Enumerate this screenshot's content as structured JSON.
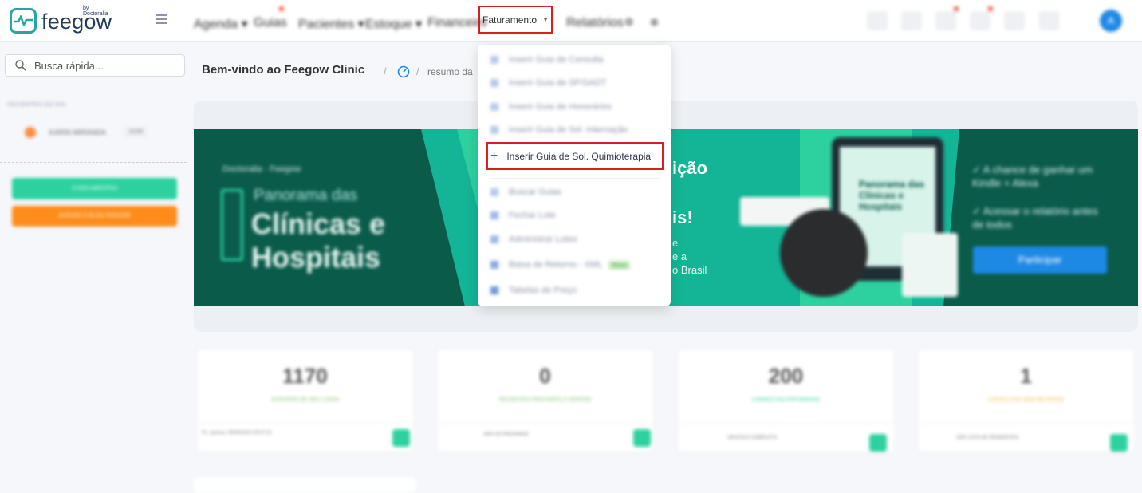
{
  "app": {
    "logo_text": "feegow",
    "logo_by": "by Doctoralia"
  },
  "nav": {
    "items": [
      "Agenda",
      "Guias",
      "Pacientes",
      "Estoque",
      "Financeiro"
    ],
    "active": "Faturamento",
    "after": [
      "Relatórios"
    ]
  },
  "search": {
    "placeholder": "Busca rápida..."
  },
  "sidebar": {
    "section_label": "PACIENTES DO DIA",
    "patient_name": "KARIN MIRANDA",
    "patient_badge": "10:00",
    "green_button": "0 DOCUMENTOS",
    "orange_button": "ACESSE O BLOG FEEGOW"
  },
  "breadcrumb": {
    "title": "Bem-vindo ao Feegow Clinic",
    "sub": "resumo da"
  },
  "dropdown": {
    "items": [
      {
        "label": "Inserir Guia de Consulta",
        "icon": "plus-icon"
      },
      {
        "label": "Inserir Guia de SP/SADT",
        "icon": "plus-icon"
      },
      {
        "label": "Inserir Guia de Honorários",
        "icon": "plus-icon"
      },
      {
        "label": "Inserir Guia de Sol. Internação",
        "icon": "plus-icon"
      }
    ],
    "highlighted": "Inserir Guia de Sol. Quimioterapia",
    "items2": [
      {
        "label": "Buscar Guias",
        "icon": "search-icon"
      },
      {
        "label": "Fechar Lote",
        "icon": "lock-icon"
      },
      {
        "label": "Administrar Lotes",
        "icon": "folder-icon"
      },
      {
        "label": "Baixa de Retorno - XML",
        "icon": "upload-icon",
        "badge": "Novo"
      },
      {
        "label": "Tabelas de Preço",
        "icon": "table-icon"
      }
    ]
  },
  "banner": {
    "brand": "Doctoralia · Feegow",
    "subtitle": "Panorama das",
    "title_line1": "Clínicas e",
    "title_line2": "Hospitais",
    "fragment_top": "ição",
    "fragment_mid": "is!",
    "fragment_lines": [
      "e",
      "e a",
      "o Brasil"
    ],
    "book_title": "Panorama das Clínicas e Hospitais",
    "checks": [
      "A chance de ganhar um Kindle + Alexa",
      "Acessar o relatório antes de todos"
    ],
    "cta": "Participar"
  },
  "stats": [
    {
      "value": "1170",
      "label": "ACESSOS DE SEU LOGIN",
      "color": "#7cc26b",
      "foot": "Fn. acesso: 09/09/2023 09:07:01"
    },
    {
      "value": "0",
      "label": "PACIENTES PROXIMOS A VENCER",
      "color": "#7cc26b",
      "foot": "VER OS PROXIMOS"
    },
    {
      "value": "200",
      "label": "CONSULTAS FATURADAS",
      "color": "#2dd1a0",
      "foot": "GRAFICO COMPLETO"
    },
    {
      "value": "1",
      "label": "CONSULTAS SEM RETORNO",
      "color": "#f0c040",
      "foot": "VER LISTA DE PENDENTES"
    }
  ]
}
